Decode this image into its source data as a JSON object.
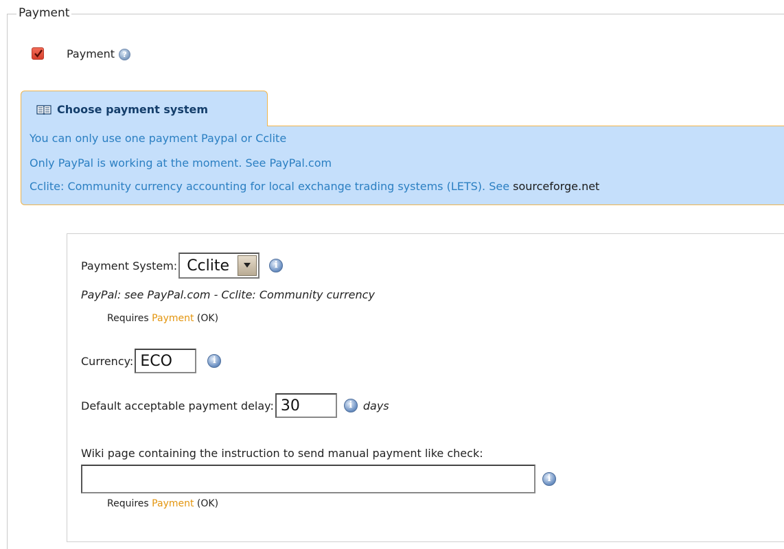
{
  "fieldset": {
    "legend": "Payment"
  },
  "payment_pref": {
    "label": "Payment",
    "checked": true,
    "help_icon": "help-icon"
  },
  "remarks": {
    "title": "Choose payment system",
    "icon": "book-icon",
    "lines": [
      "You can only use one payment Paypal or Cclite",
      "Only PayPal is working at the moment. See PayPal.com"
    ],
    "line3_text": "Cclite: Community currency accounting for local exchange trading systems (LETS). See ",
    "line3_link": "sourceforge.net"
  },
  "payment_system": {
    "label": "Payment System:",
    "value": "Cclite",
    "description": "PayPal: see PayPal.com - Cclite: Community currency",
    "requires_prefix": "Requires",
    "requires_link": "Payment",
    "requires_suffix": "(OK)"
  },
  "currency": {
    "label": "Currency:",
    "value": "ECO"
  },
  "payment_delay": {
    "label": "Default acceptable payment delay:",
    "value": "30",
    "unit": "days"
  },
  "manual_payment": {
    "label": "Wiki page containing the instruction to send manual payment like check:",
    "value": "",
    "requires_prefix": "Requires",
    "requires_link": "Payment",
    "requires_suffix": "(OK)"
  },
  "colors": {
    "accent_orange": "#f0b44a",
    "remark_bg": "#c5dffb",
    "remark_text": "#2b7fc2",
    "link": "#e3950e"
  }
}
